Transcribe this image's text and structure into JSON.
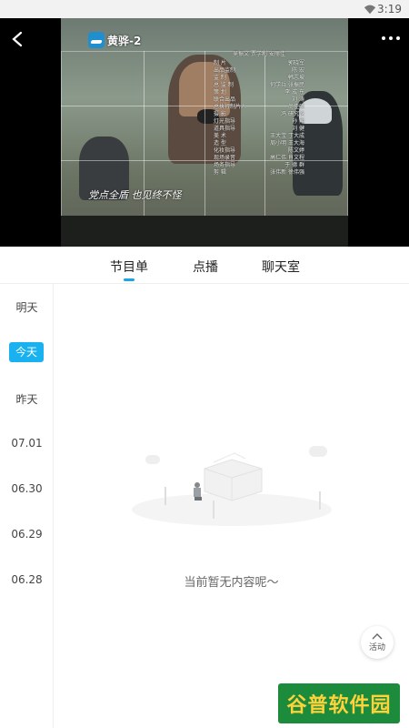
{
  "status_bar": {
    "time": "3:19",
    "wifi_icon": "wifi-icon"
  },
  "player": {
    "back_icon": "chevron-left-icon",
    "more_icon": "more-dots-icon",
    "channel_name": "黄骅-2",
    "subtitle": "党点全盾 也见终不怪",
    "credits_header": "吴振文 贾学利 安丽佳",
    "credits": [
      [
        "制 片",
        "郭晓军"
      ],
      [
        "出品监制",
        "陈 宏"
      ],
      [
        "监 制",
        "韩志坡"
      ],
      [
        "总 监 制",
        "何学兵 张振民"
      ],
      [
        "策 划",
        "李 成 东"
      ],
      [
        "联合出品",
        "刘 涛"
      ],
      [
        "总执行制片人",
        "尚佳硕"
      ],
      [
        "摄 影",
        "冯 研究论"
      ],
      [
        "灯光指导",
        "孙 翔"
      ],
      [
        "道具指导",
        "刘 健"
      ],
      [
        "美 术",
        "王大宝 丁大成"
      ],
      [
        "造 型",
        "周小明 王大海"
      ],
      [
        "化妆指导",
        "陈文婷"
      ],
      [
        "现场录音",
        "高仁伟 肖文程"
      ],
      [
        "场务指导",
        "于 德 群"
      ],
      [
        "剪 辑",
        "张伟新 徐伟强"
      ]
    ]
  },
  "tabs": [
    {
      "label": "节目单",
      "active": true
    },
    {
      "label": "点播",
      "active": false
    },
    {
      "label": "聊天室",
      "active": false
    }
  ],
  "dates": [
    {
      "label": "明天",
      "active": false
    },
    {
      "label": "今天",
      "active": true
    },
    {
      "label": "昨天",
      "active": false
    },
    {
      "label": "07.01",
      "active": false
    },
    {
      "label": "06.30",
      "active": false
    },
    {
      "label": "06.29",
      "active": false
    },
    {
      "label": "06.28",
      "active": false
    }
  ],
  "empty_state": {
    "message": "当前暂无内容呢～",
    "illustration": "empty-box-illustration"
  },
  "activity_button": {
    "label": "活动",
    "icon": "chevron-up-icon"
  },
  "watermark": {
    "text": "谷普软件园"
  },
  "colors": {
    "accent": "#19b1ef",
    "watermark_bg": "#1c8c3c",
    "watermark_text": "#ffd23a"
  }
}
